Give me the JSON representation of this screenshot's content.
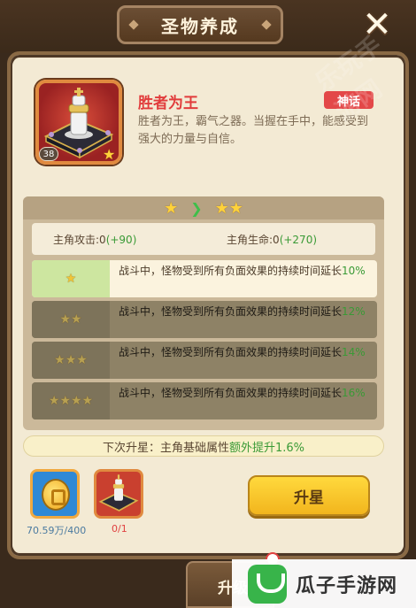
{
  "header": {
    "title": "圣物养成",
    "close_icon": "close-icon"
  },
  "relic": {
    "name": "胜者为王",
    "rarity": "神话",
    "level": "38",
    "description": "胜者为王，霸气之器。当握在手中，能感受到强大的力量与自信。"
  },
  "star_change": {
    "from_stars": 1,
    "to_stars": 2
  },
  "stats": {
    "attack_label": "主角攻击:0",
    "attack_bonus": "(+90)",
    "hp_label": "主角生命:0",
    "hp_bonus": "(+270)"
  },
  "effects": [
    {
      "stars": 1,
      "text_a": "战斗中，怪物受到所有负面效果的持续时间延长",
      "pct": "10%",
      "unlocked": true
    },
    {
      "stars": 2,
      "text_a": "战斗中，怪物受到所有负面效果的持续时间延长",
      "pct": "12%",
      "unlocked": false
    },
    {
      "stars": 3,
      "text_a": "战斗中，怪物受到所有负面效果的持续时间延长",
      "pct": "14%",
      "unlocked": false
    },
    {
      "stars": 4,
      "text_a": "战斗中，怪物受到所有负面效果的持续时间延长",
      "pct": "16%",
      "unlocked": false
    }
  ],
  "next_star": {
    "prefix": "下次升星：主角基础属性",
    "highlight": "额外提升1.6%"
  },
  "costs": {
    "coin_amount": "70.59万/400",
    "relic_amount": "0/1"
  },
  "upgrade_button": "升星",
  "bottom_tab": "升级",
  "watermark": {
    "text": "瓜子手游网",
    "faint": "乐玩手游网"
  },
  "colors": {
    "accent_red": "#e13c3c",
    "bonus_green": "#3a9a36",
    "button_yellow": "#f2b51d"
  }
}
